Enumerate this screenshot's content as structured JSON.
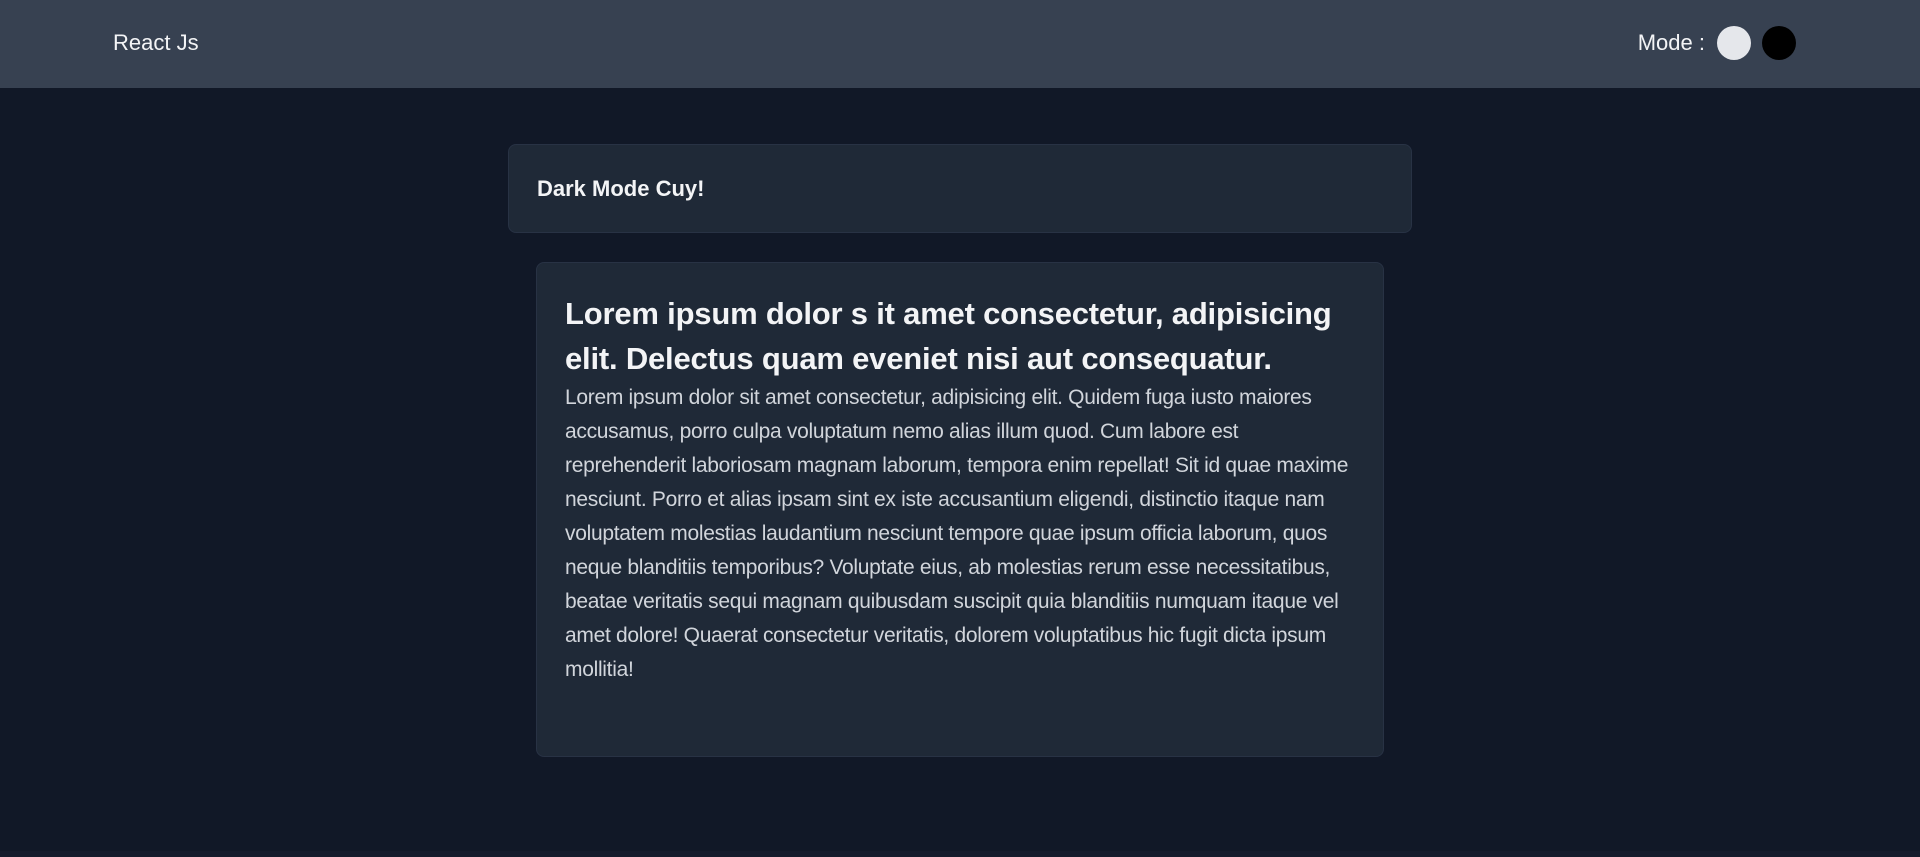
{
  "navbar": {
    "brand": "React Js",
    "mode_label": "Mode :",
    "modes": [
      {
        "name": "light",
        "color": "#e5e7eb"
      },
      {
        "name": "dark",
        "color": "#000000"
      }
    ]
  },
  "header_card": {
    "title": "Dark Mode Cuy!"
  },
  "article": {
    "title": "Lorem ipsum dolor s it amet consectetur, adipisicing elit. Delectus quam eveniet nisi aut consequatur.",
    "body": "Lorem ipsum dolor sit amet consectetur, adipisicing elit. Quidem fuga iusto maiores accusamus, porro culpa voluptatum nemo alias illum quod. Cum labore est reprehenderit laboriosam magnam laborum, tempora enim repellat! Sit id quae maxime nesciunt. Porro et alias ipsam sint ex iste accusantium eligendi, distinctio itaque nam voluptatem molestias laudantium nesciunt tempore quae ipsum officia laborum, quos neque blanditiis temporibus? Voluptate eius, ab molestias rerum esse necessitatibus, beatae veritatis sequi magnam quibusdam suscipit quia blanditiis numquam itaque vel amet dolore! Quaerat consectetur veritatis, dolorem voluptatibus hic fugit dicta ipsum mollitia!"
  },
  "colors": {
    "page_background": "#111827",
    "navbar_background": "#374151",
    "card_background": "#1f2937",
    "text_primary": "#f3f4f6",
    "text_secondary": "#d1d5db"
  }
}
